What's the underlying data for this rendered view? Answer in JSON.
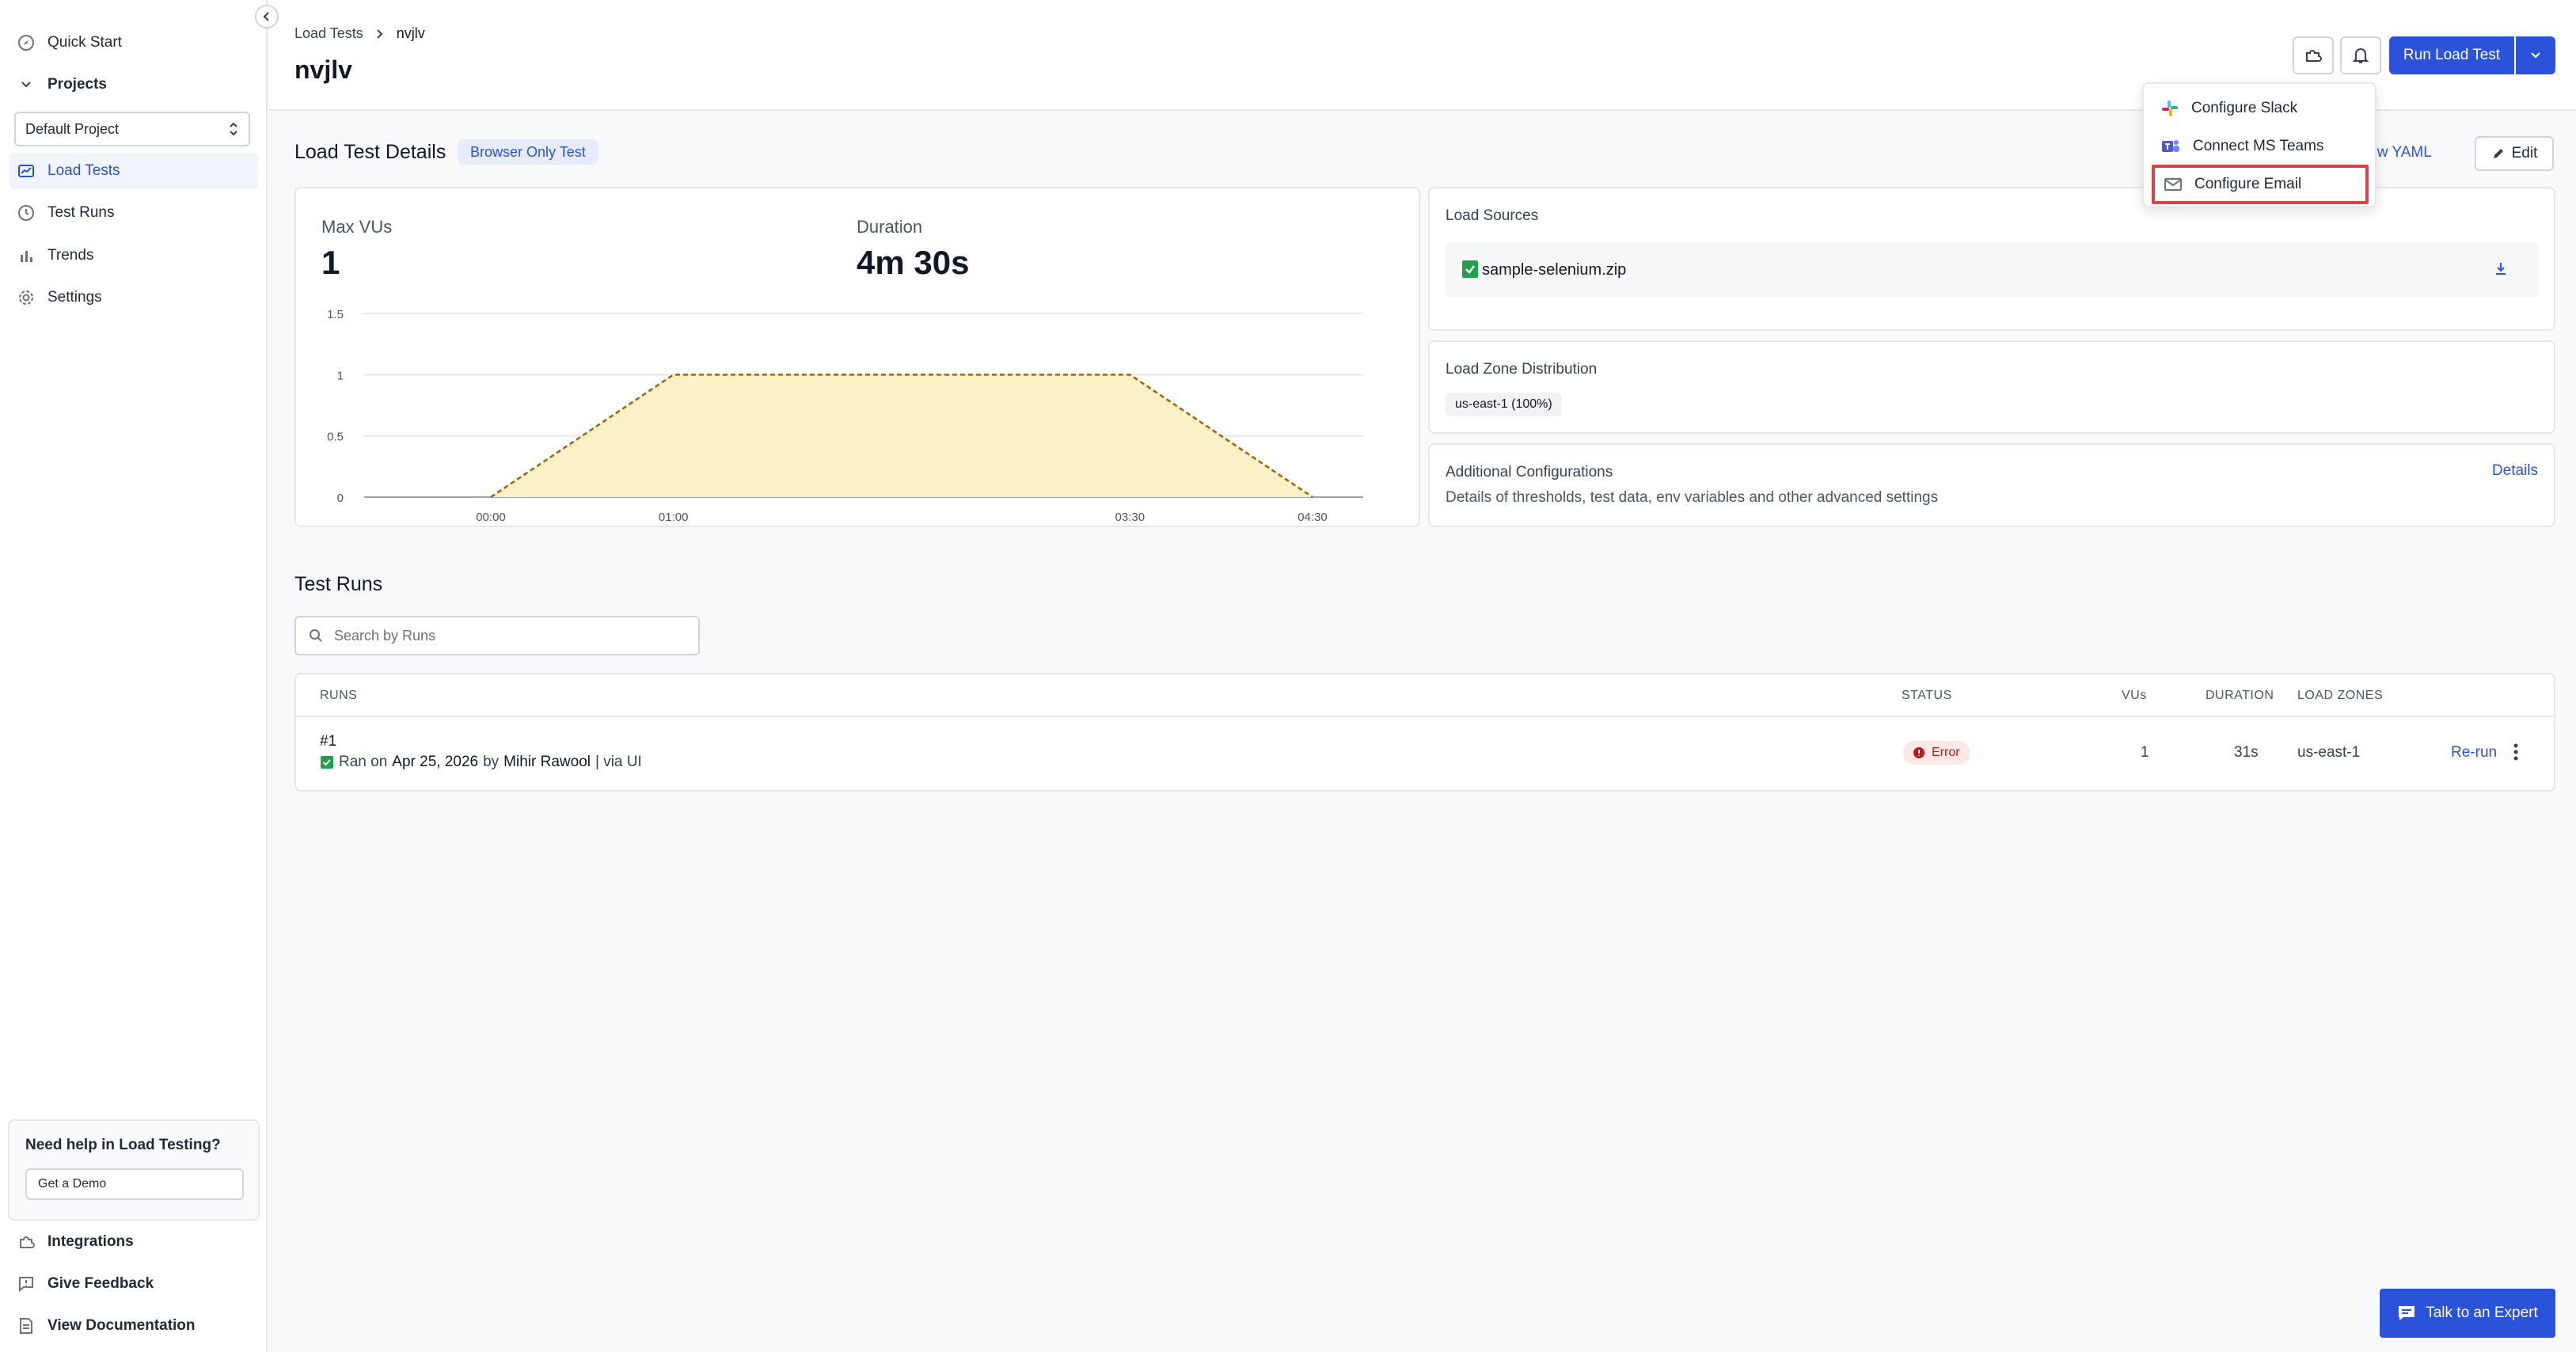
{
  "sidebar": {
    "quick_start": "Quick Start",
    "projects": "Projects",
    "project_selected": "Default Project",
    "items": [
      {
        "label": "Load Tests"
      },
      {
        "label": "Test Runs"
      },
      {
        "label": "Trends"
      },
      {
        "label": "Settings"
      }
    ],
    "help_title": "Need help in Load Testing?",
    "help_button": "Get a Demo",
    "footer": [
      {
        "label": "Integrations"
      },
      {
        "label": "Give Feedback"
      },
      {
        "label": "View Documentation"
      }
    ]
  },
  "header": {
    "breadcrumb_root": "Load Tests",
    "breadcrumb_current": "nvjlv",
    "title": "nvjlv",
    "run_button": "Run Load Test"
  },
  "menu": {
    "items": [
      {
        "label": "Configure Slack",
        "icon": "slack-icon"
      },
      {
        "label": "Connect MS Teams",
        "icon": "teams-icon"
      },
      {
        "label": "Configure Email",
        "icon": "mail-icon"
      }
    ]
  },
  "details": {
    "title": "Load Test Details",
    "badge": "Browser Only Test",
    "view_yaml": "iew YAML",
    "edit": "Edit",
    "max_vus_label": "Max VUs",
    "max_vus_value": "1",
    "duration_label": "Duration",
    "duration_value": "4m 30s"
  },
  "chart_data": {
    "type": "area",
    "x": [
      "00:00",
      "01:00",
      "03:30",
      "04:30"
    ],
    "values": [
      0,
      1,
      1,
      0
    ],
    "y_ticks": [
      "1.5",
      "1",
      "0.5",
      "0"
    ],
    "ylim": [
      0,
      1.5
    ],
    "grid": true,
    "fill": "#fbf1c7",
    "stroke": "#a16207"
  },
  "sources": {
    "title": "Load Sources",
    "file": "sample-selenium.zip"
  },
  "zones": {
    "title": "Load Zone Distribution",
    "chip": "us-east-1 (100%)"
  },
  "additional": {
    "title": "Additional Configurations",
    "desc": "Details of thresholds, test data, env variables and other advanced settings",
    "link": "Details"
  },
  "runs": {
    "title": "Test Runs",
    "search_placeholder": "Search by Runs",
    "headers": {
      "runs": "RUNS",
      "status": "STATUS",
      "vus": "VUs",
      "duration": "DURATION",
      "zones": "LOAD ZONES"
    },
    "row": {
      "id": "#1",
      "meta_prefix": "Ran on",
      "date": "Apr 25, 2026",
      "by": "by",
      "user": "Mihir Rawool",
      "via": "| via UI",
      "status": "Error",
      "vus": "1",
      "duration": "31s",
      "zone": "us-east-1",
      "rerun": "Re-run"
    }
  },
  "expert_button": "Talk to an Expert",
  "colors": {
    "accent": "#2b53d9",
    "error": "#b91c1c",
    "highlight": "#d64545"
  }
}
